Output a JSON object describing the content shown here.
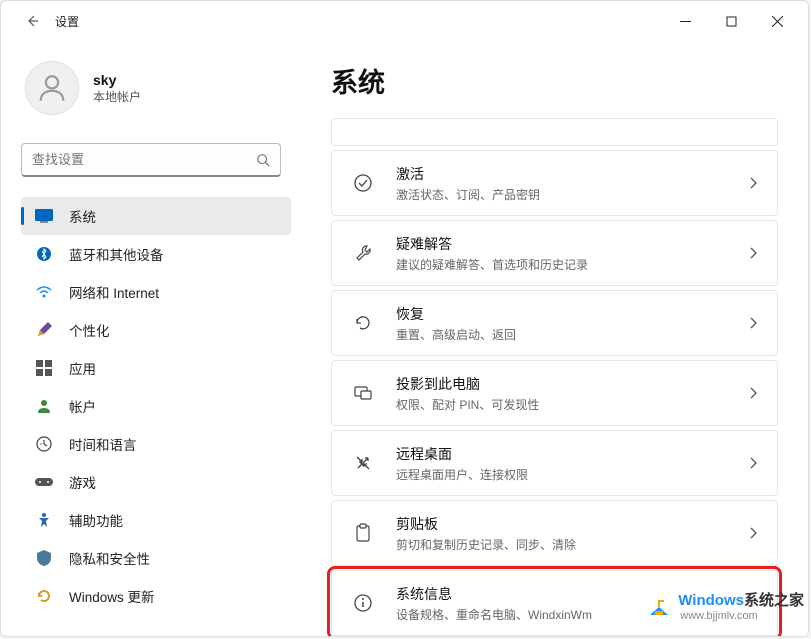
{
  "window": {
    "title": "设置"
  },
  "profile": {
    "name": "sky",
    "subtitle": "本地帐户"
  },
  "search": {
    "placeholder": "查找设置"
  },
  "nav": [
    {
      "label": "系统",
      "icon": "system"
    },
    {
      "label": "蓝牙和其他设备",
      "icon": "bluetooth"
    },
    {
      "label": "网络和 Internet",
      "icon": "network"
    },
    {
      "label": "个性化",
      "icon": "personalize"
    },
    {
      "label": "应用",
      "icon": "apps"
    },
    {
      "label": "帐户",
      "icon": "account"
    },
    {
      "label": "时间和语言",
      "icon": "time"
    },
    {
      "label": "游戏",
      "icon": "gaming"
    },
    {
      "label": "辅助功能",
      "icon": "accessibility"
    },
    {
      "label": "隐私和安全性",
      "icon": "privacy"
    },
    {
      "label": "Windows 更新",
      "icon": "update"
    }
  ],
  "main": {
    "title": "系统",
    "cards": [
      {
        "title": "激活",
        "subtitle": "激活状态、订阅、产品密钥",
        "icon": "activation"
      },
      {
        "title": "疑难解答",
        "subtitle": "建议的疑难解答、首选项和历史记录",
        "icon": "troubleshoot"
      },
      {
        "title": "恢复",
        "subtitle": "重置、高级启动、返回",
        "icon": "recovery"
      },
      {
        "title": "投影到此电脑",
        "subtitle": "权限、配对 PIN、可发现性",
        "icon": "project"
      },
      {
        "title": "远程桌面",
        "subtitle": "远程桌面用户、连接权限",
        "icon": "remote"
      },
      {
        "title": "剪贴板",
        "subtitle": "剪切和复制历史记录、同步、清除",
        "icon": "clipboard"
      },
      {
        "title": "系统信息",
        "subtitle": "设备规格、重命名电脑、WindxinWm",
        "icon": "about"
      }
    ]
  },
  "watermark": {
    "brand1": "Windows",
    "brand2": "系统之家",
    "url": "www.bjjmlv.com"
  }
}
